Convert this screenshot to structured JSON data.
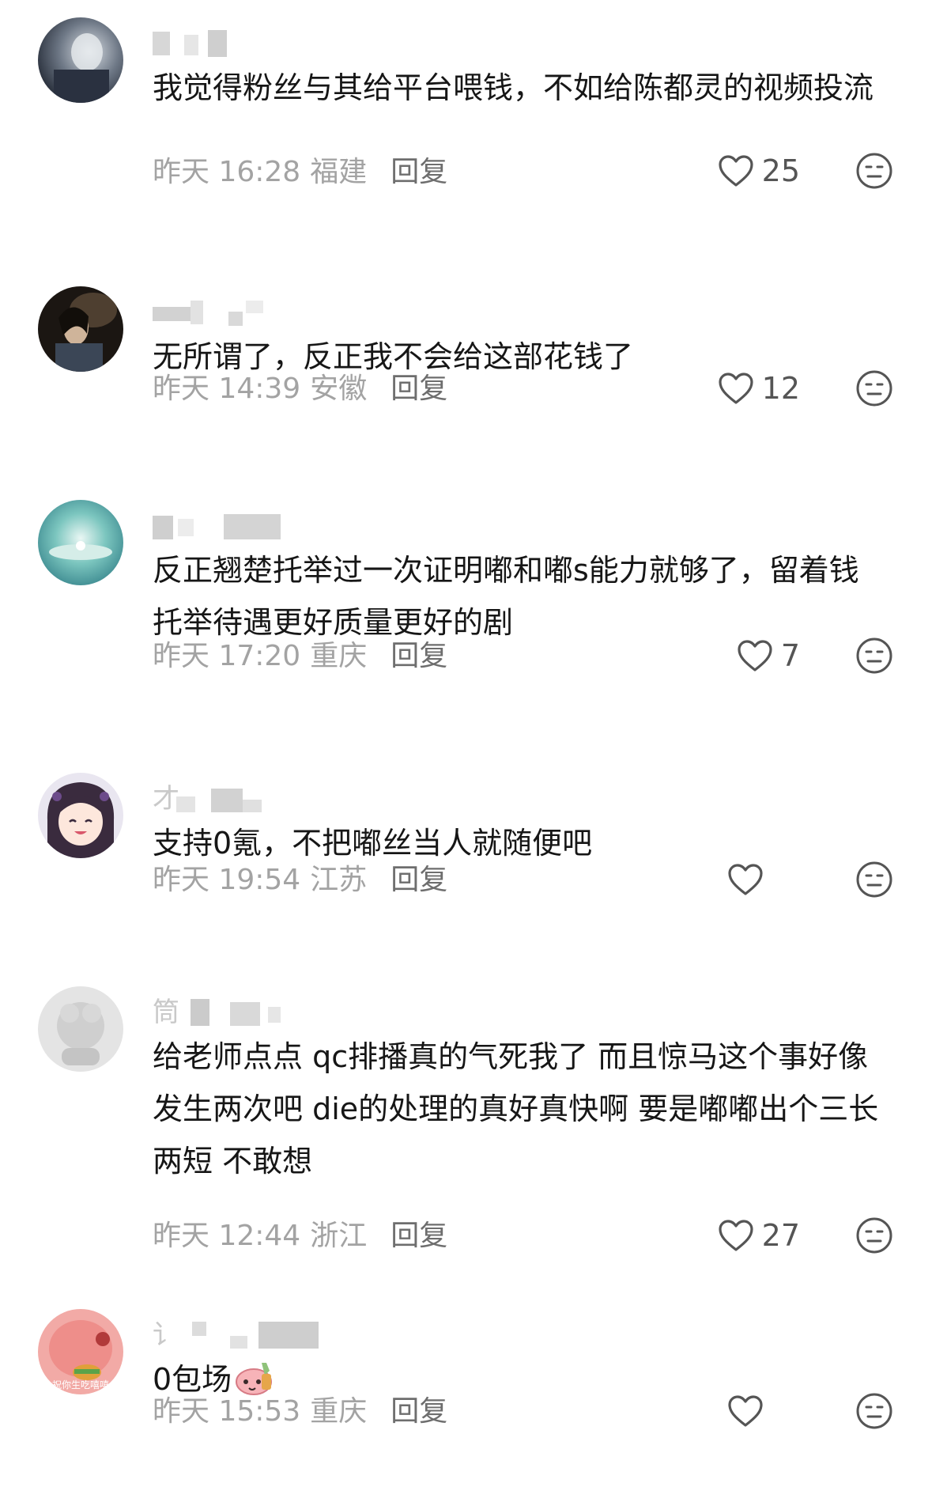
{
  "comments": [
    {
      "content": "我觉得粉丝与其给平台喂钱，不如给陈都灵的视频投流",
      "time": "昨天 16:28",
      "location": "福建",
      "reply_label": "回复",
      "likes": "25"
    },
    {
      "content": "无所谓了，反正我不会给这部花钱了",
      "time": "昨天 14:39",
      "location": "安徽",
      "reply_label": "回复",
      "likes": "12"
    },
    {
      "content": "反正翘楚托举过一次证明嘟和嘟s能力就够了，留着钱托举待遇更好质量更好的剧",
      "time": "昨天 17:20",
      "location": "重庆",
      "reply_label": "回复",
      "likes": "7"
    },
    {
      "username_visible": "才",
      "content": "支持0氪，不把嘟丝当人就随便吧",
      "time": "昨天 19:54",
      "location": "江苏",
      "reply_label": "回复",
      "likes": ""
    },
    {
      "username_visible": "筒",
      "content": "给老师点点   qc排播真的气死我了  而且惊马这个事好像发生两次吧   die的处理的真好真快啊  要是嘟嘟出个三长两短 不敢想",
      "time": "昨天 12:44",
      "location": "浙江",
      "reply_label": "回复",
      "likes": "27"
    },
    {
      "username_visible": "讠",
      "content": "0包场",
      "time": "昨天 15:53",
      "location": "重庆",
      "reply_label": "回复",
      "likes": "",
      "avatar_text": "祝你生吃嘻嘻"
    }
  ],
  "icons": {
    "like": "heart-outline-icon",
    "dislike": "meh-face-icon",
    "sticker": "pink-blob-sticker"
  },
  "colors": {
    "meta_gray": "#a3a3a3",
    "reply_gray": "#6e6e6e",
    "icon_gray": "#555555"
  }
}
